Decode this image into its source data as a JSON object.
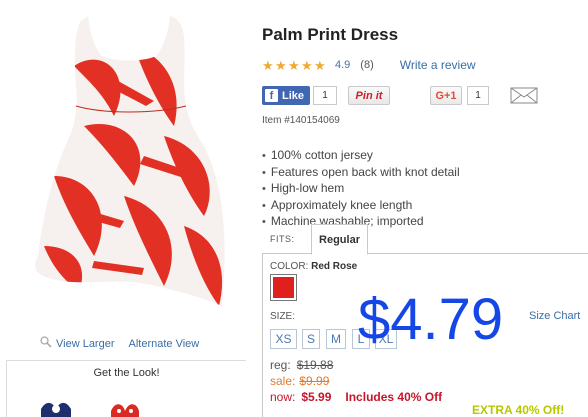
{
  "product": {
    "title": "Palm Print Dress",
    "rating_value": "4.9",
    "rating_count": "(8)",
    "rating_stars": 4.9,
    "write_review": "Write a review",
    "item_number": "Item #140154069"
  },
  "social": {
    "fb_like": "Like",
    "fb_count": "1",
    "pinit": "Pin it",
    "gplus": "G+1",
    "gplus_count": "1"
  },
  "gallery": {
    "view_larger": "View Larger",
    "alternate_view": "Alternate View",
    "get_the_look": "Get the Look!"
  },
  "features": [
    "100% cotton jersey",
    "Features open back with knot detail",
    "High-low hem",
    "Approximately knee length",
    "Machine washable; imported"
  ],
  "fit": {
    "label": "FITS:",
    "selected": "Regular"
  },
  "color": {
    "label": "COLOR:",
    "selected": "Red Rose",
    "swatch_color": "#e0201e"
  },
  "size": {
    "label": "SIZE:",
    "chart_link": "Size Chart",
    "options": [
      "XS",
      "S",
      "M",
      "L",
      "XL"
    ]
  },
  "pricing": {
    "overlay_price": "$4.79",
    "reg_label": "reg:",
    "reg_price": "$19.88",
    "sale_label": "sale:",
    "sale_price": "$9.99",
    "now_label": "now:",
    "now_price": "$5.99",
    "now_note": "Includes 40% Off",
    "extra_off": "EXTRA 40% Off!"
  },
  "colors": {
    "link": "#3a6ea5",
    "star": "#f0a92c",
    "now_red": "#c5162c",
    "sale_orange": "#e07a2c",
    "overlay_blue": "#1546e6",
    "extra_green": "#b5c800"
  }
}
